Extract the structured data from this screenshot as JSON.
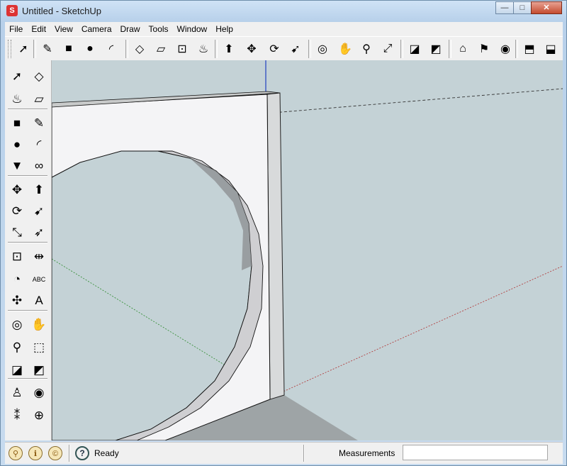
{
  "window": {
    "title": "Untitled - SketchUp",
    "app_icon": "sketchup-logo-icon"
  },
  "window_controls": {
    "minimize": "—",
    "maximize": "□",
    "close": "✕"
  },
  "menu": [
    {
      "label": "File",
      "accel": "F"
    },
    {
      "label": "Edit",
      "accel": "E"
    },
    {
      "label": "View",
      "accel": "V"
    },
    {
      "label": "Camera",
      "accel": "C"
    },
    {
      "label": "Draw",
      "accel": "D"
    },
    {
      "label": "Tools",
      "accel": "T"
    },
    {
      "label": "Window",
      "accel": "W"
    },
    {
      "label": "Help",
      "accel": "H"
    }
  ],
  "top_toolbar": [
    {
      "name": "select-tool-icon",
      "glyph": "➚"
    },
    {
      "name": "line-tool-icon",
      "glyph": "✎"
    },
    {
      "name": "rectangle-tool-icon",
      "glyph": "■"
    },
    {
      "name": "circle-tool-icon",
      "glyph": "●"
    },
    {
      "name": "arc-tool-icon",
      "glyph": "◜"
    },
    {
      "name": "make-component-icon",
      "glyph": "◇"
    },
    {
      "name": "eraser-tool-icon",
      "glyph": "▱"
    },
    {
      "name": "tape-measure-icon",
      "glyph": "⊡"
    },
    {
      "name": "paint-bucket-icon",
      "glyph": "♨"
    },
    {
      "name": "push-pull-icon",
      "glyph": "⬆"
    },
    {
      "name": "move-tool-icon",
      "glyph": "✥"
    },
    {
      "name": "rotate-tool-icon",
      "glyph": "⟳"
    },
    {
      "name": "follow-me-icon",
      "glyph": "➹"
    },
    {
      "name": "orbit-tool-icon",
      "glyph": "◎"
    },
    {
      "name": "pan-tool-icon",
      "glyph": "✋"
    },
    {
      "name": "zoom-tool-icon",
      "glyph": "⚲"
    },
    {
      "name": "zoom-extents-icon",
      "glyph": "⤢"
    },
    {
      "name": "previous-view-icon",
      "glyph": "◪"
    },
    {
      "name": "next-view-icon",
      "glyph": "◩"
    },
    {
      "name": "3d-warehouse-icon",
      "glyph": "⌂"
    },
    {
      "name": "get-models-icon",
      "glyph": "⚑"
    },
    {
      "name": "google-earth-icon",
      "glyph": "◉"
    },
    {
      "name": "share-component-icon",
      "glyph": "⬒"
    },
    {
      "name": "share-model-icon",
      "glyph": "⬓"
    }
  ],
  "left_toolbar": [
    {
      "name": "select-tool-icon",
      "glyph": "➚"
    },
    {
      "name": "make-component-icon",
      "glyph": "◇"
    },
    {
      "name": "paint-bucket-icon",
      "glyph": "♨"
    },
    {
      "name": "eraser-tool-icon",
      "glyph": "▱"
    },
    {
      "name": "rectangle-tool-icon",
      "glyph": "■"
    },
    {
      "name": "line-tool-icon",
      "glyph": "✎"
    },
    {
      "name": "circle-tool-icon",
      "glyph": "●"
    },
    {
      "name": "arc-tool-icon",
      "glyph": "◜"
    },
    {
      "name": "polygon-tool-icon",
      "glyph": "▼"
    },
    {
      "name": "freehand-tool-icon",
      "glyph": "∞"
    },
    {
      "name": "move-tool-icon",
      "glyph": "✥"
    },
    {
      "name": "push-pull-icon",
      "glyph": "⬆"
    },
    {
      "name": "rotate-tool-icon",
      "glyph": "⟳"
    },
    {
      "name": "follow-me-icon",
      "glyph": "➹"
    },
    {
      "name": "scale-tool-icon",
      "glyph": "⤡"
    },
    {
      "name": "offset-tool-icon",
      "glyph": "➶"
    },
    {
      "name": "tape-measure-icon",
      "glyph": "⊡"
    },
    {
      "name": "dimension-tool-icon",
      "glyph": "⇹"
    },
    {
      "name": "protractor-tool-icon",
      "glyph": "◔"
    },
    {
      "name": "text-tool-icon",
      "glyph": "ABC"
    },
    {
      "name": "axes-tool-icon",
      "glyph": "✣"
    },
    {
      "name": "3d-text-tool-icon",
      "glyph": "A"
    },
    {
      "name": "orbit-tool-icon",
      "glyph": "◎"
    },
    {
      "name": "pan-tool-icon",
      "glyph": "✋"
    },
    {
      "name": "zoom-tool-icon",
      "glyph": "⚲"
    },
    {
      "name": "zoom-window-icon",
      "glyph": "⬚"
    },
    {
      "name": "previous-view-icon",
      "glyph": "◪"
    },
    {
      "name": "next-view-icon",
      "glyph": "◩"
    },
    {
      "name": "position-camera-icon",
      "glyph": "♙"
    },
    {
      "name": "look-around-icon",
      "glyph": "◉"
    },
    {
      "name": "walk-tool-icon",
      "glyph": "⁑"
    },
    {
      "name": "section-plane-icon",
      "glyph": "⊕"
    }
  ],
  "status": {
    "text": "Ready",
    "help_glyph": "?",
    "geo_icon_glyph": "⚲",
    "credit_icon_glyph": "ℹ",
    "signin_icon_glyph": "©",
    "measurements_label": "Measurements",
    "measurements_value": ""
  }
}
